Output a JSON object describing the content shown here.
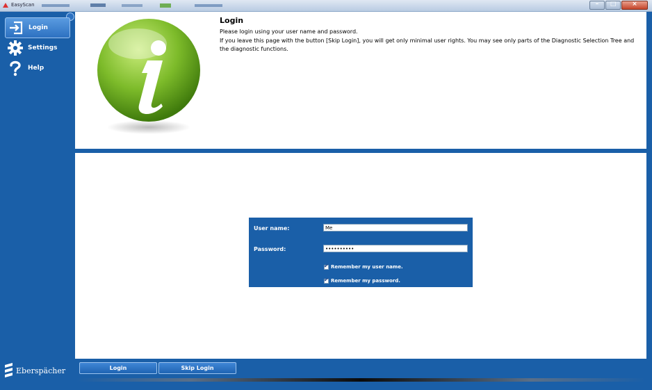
{
  "window": {
    "title": "EasyScan"
  },
  "sidebar": {
    "items": [
      {
        "label": "Login",
        "icon": "login-icon",
        "active": true
      },
      {
        "label": "Settings",
        "icon": "gear-icon",
        "active": false
      },
      {
        "label": "Help",
        "icon": "question-icon",
        "active": false
      }
    ]
  },
  "logo": {
    "text": "Eberspächer"
  },
  "info": {
    "title": "Login",
    "line1": "Please login using your user name and password.",
    "line2": "If you leave this page with the button [Skip Login], you will get only minimal user rights. You may see only parts of the Diagnostic Selection Tree and the diagnostic functions."
  },
  "form": {
    "username_label": "User name:",
    "username_value": "Me",
    "password_label": "Password:",
    "password_value": "••••••••••",
    "remember_user_label": "Remember my user name.",
    "remember_user_checked": true,
    "remember_pass_label": "Remember my password.",
    "remember_pass_checked": true
  },
  "buttons": {
    "login": "Login",
    "skip": "Skip Login"
  },
  "colors": {
    "brand_blue": "#1a5fa8",
    "icon_green": "#7dbb2a"
  }
}
